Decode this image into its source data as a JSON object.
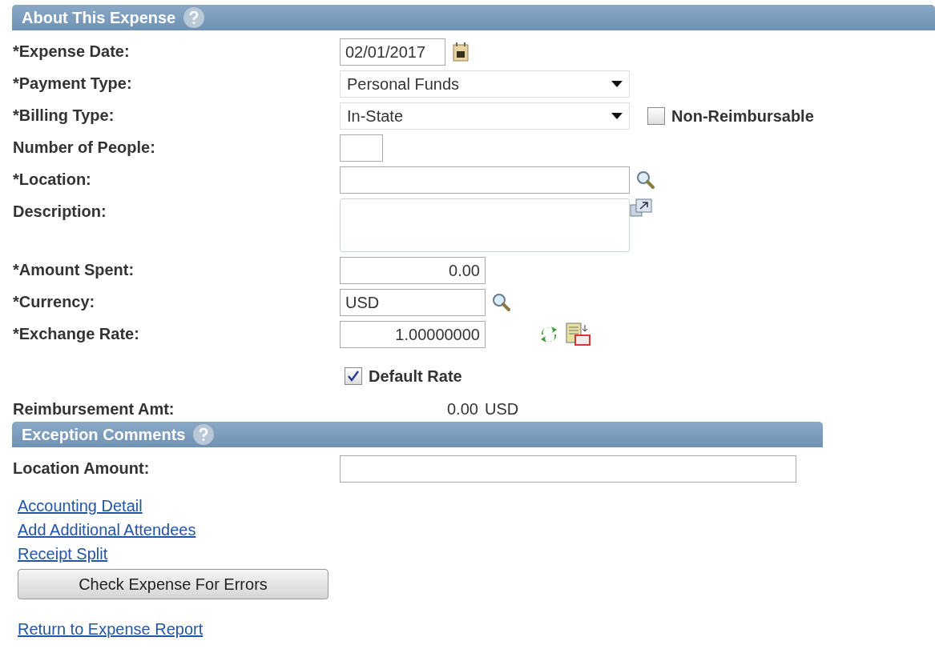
{
  "sections": [
    {
      "title": "About This Expense",
      "help": true,
      "fields": [
        {
          "kind": "date",
          "label": "*Expense Date:",
          "value": "02/01/2017"
        },
        {
          "kind": "select",
          "label": "*Payment Type:",
          "value": "Personal Funds"
        },
        {
          "kind": "select",
          "label": "*Billing Type:",
          "value": "In-State",
          "checkbox": {
            "label": "Non-Reimbursable",
            "checked": false
          }
        },
        {
          "kind": "short",
          "label": "Number of People:"
        },
        {
          "kind": "lookup",
          "label": "*Location:"
        },
        {
          "kind": "textarea",
          "label": "Description:"
        },
        {
          "kind": "amount",
          "label": "*Amount Spent:",
          "value": "0.00"
        },
        {
          "kind": "lookup-short",
          "label": "*Currency:",
          "value": "USD"
        },
        {
          "kind": "rate",
          "label": "*Exchange Rate:",
          "value": "1.00000000"
        },
        {
          "kind": "checkbox",
          "label": "Default Rate",
          "checked": true
        },
        {
          "kind": "readout",
          "label": "Reimbursement Amt:",
          "value": "0.00",
          "unit": "USD"
        }
      ]
    },
    {
      "title": "Exception Comments",
      "help": true,
      "fields": [
        {
          "kind": "wide",
          "label": "Location Amount:"
        }
      ]
    }
  ],
  "links": [
    "Accounting Detail",
    "Add Additional Attendees",
    "Receipt Split"
  ],
  "button": "Check Expense For Errors",
  "return_link": "Return to Expense Report"
}
